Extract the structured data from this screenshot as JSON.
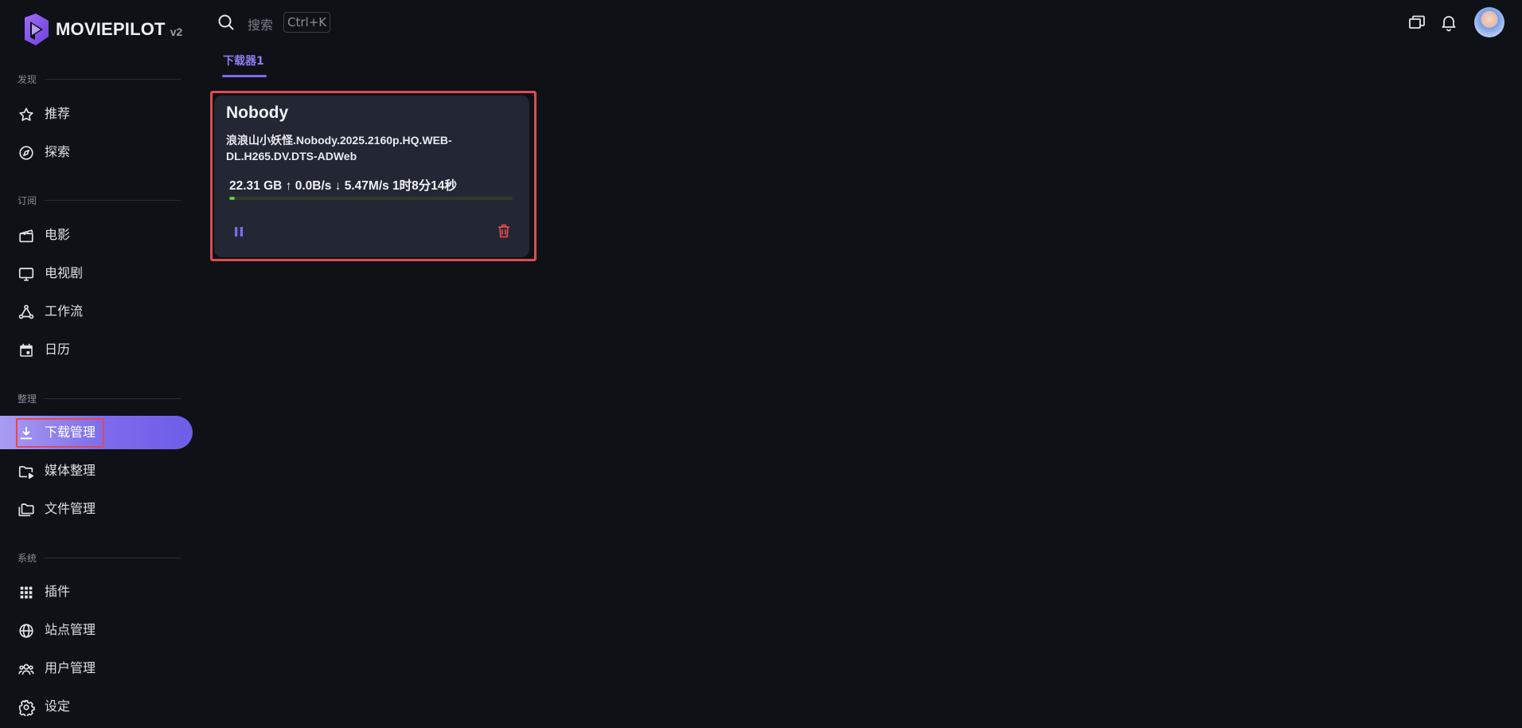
{
  "brand": {
    "name": "MOVIEPILOT",
    "version": "v2"
  },
  "topbar": {
    "search_label": "搜索",
    "search_shortcut": "Ctrl+K"
  },
  "sidebar": {
    "sections": [
      {
        "title": "发现",
        "items": [
          {
            "label": "推荐",
            "icon": "star-icon"
          },
          {
            "label": "探索",
            "icon": "compass-icon"
          }
        ]
      },
      {
        "title": "订阅",
        "items": [
          {
            "label": "电影",
            "icon": "clapperboard-icon"
          },
          {
            "label": "电视剧",
            "icon": "tv-icon"
          },
          {
            "label": "工作流",
            "icon": "workflow-icon"
          },
          {
            "label": "日历",
            "icon": "calendar-icon"
          }
        ]
      },
      {
        "title": "整理",
        "items": [
          {
            "label": "下载管理",
            "icon": "download-icon",
            "active": true
          },
          {
            "label": "媒体整理",
            "icon": "media-folder-icon"
          },
          {
            "label": "文件管理",
            "icon": "folders-icon"
          }
        ]
      },
      {
        "title": "系统",
        "items": [
          {
            "label": "插件",
            "icon": "grid-icon"
          },
          {
            "label": "站点管理",
            "icon": "globe-icon"
          },
          {
            "label": "用户管理",
            "icon": "users-icon"
          },
          {
            "label": "设定",
            "icon": "gear-icon"
          }
        ]
      }
    ]
  },
  "tabs": [
    {
      "label": "下载器1",
      "active": true
    }
  ],
  "downloads": [
    {
      "title": "Nobody",
      "filename": "浪浪山小妖怪.Nobody.2025.2160p.HQ.WEB-DL.H265.DV.DTS-ADWeb",
      "stats": "22.31 GB ↑ 0.0B/s ↓ 5.47M/s 1时8分14秒",
      "progress_percent": 2
    }
  ],
  "colors": {
    "accent": "#7c6bec",
    "progress": "#62c63a",
    "danger": "#e34a4f",
    "background": "#0e1116",
    "card": "#222733"
  }
}
